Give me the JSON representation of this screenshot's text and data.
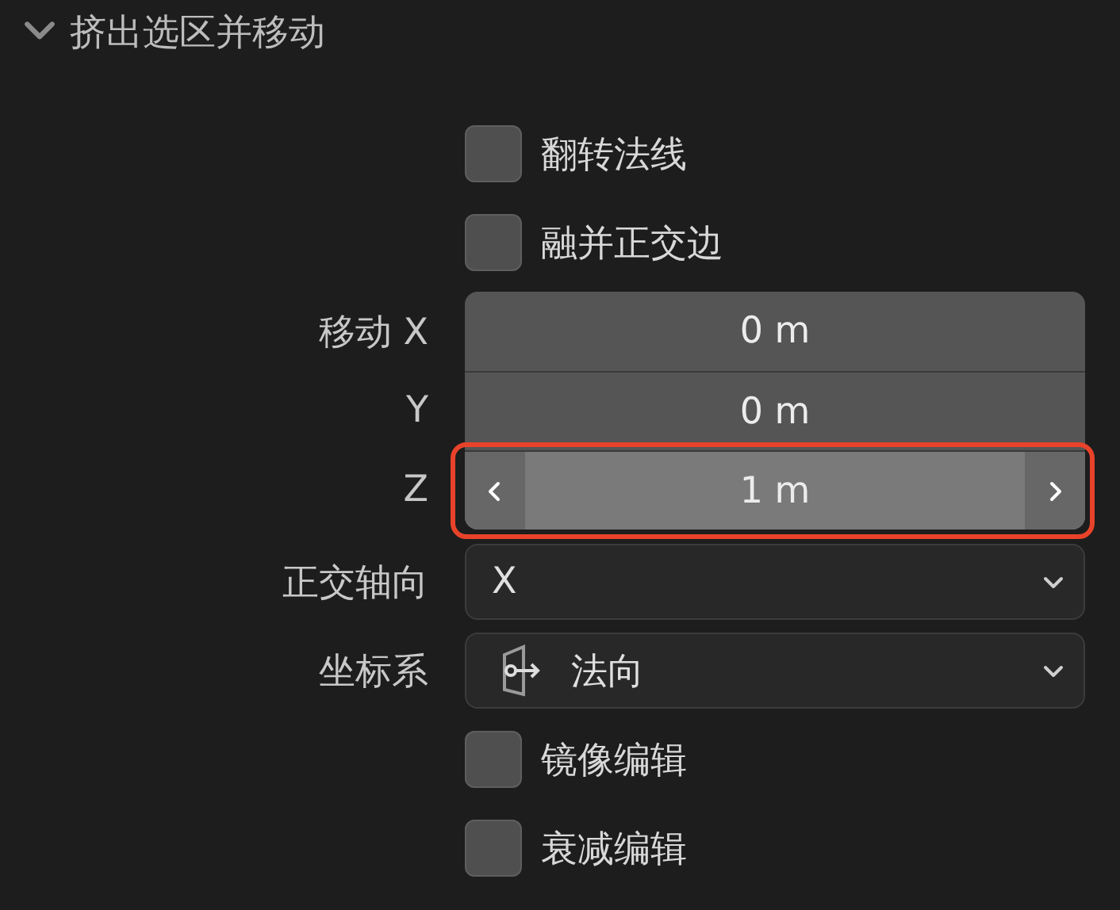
{
  "panel": {
    "title": "挤出选区并移动",
    "expanded": true
  },
  "options": [
    {
      "kind": "checkbox",
      "label": "翻转法线",
      "checked": false
    },
    {
      "kind": "checkbox",
      "label": "融并正交边",
      "checked": false
    },
    {
      "kind": "number",
      "label": "移动 X",
      "value": "0 m",
      "hovered": false,
      "highlighted": false
    },
    {
      "kind": "number",
      "label": "Y",
      "value": "0 m",
      "hovered": false,
      "highlighted": false
    },
    {
      "kind": "number",
      "label": "Z",
      "value": "1 m",
      "hovered": true,
      "highlighted": true
    },
    {
      "kind": "dropdown",
      "label": "正交轴向",
      "value": "X",
      "has_icon": false
    },
    {
      "kind": "dropdown",
      "label": "坐标系",
      "value": "法向",
      "has_icon": true
    },
    {
      "kind": "checkbox",
      "label": "镜像编辑",
      "checked": false
    },
    {
      "kind": "checkbox",
      "label": "衰减编辑",
      "checked": false
    }
  ]
}
